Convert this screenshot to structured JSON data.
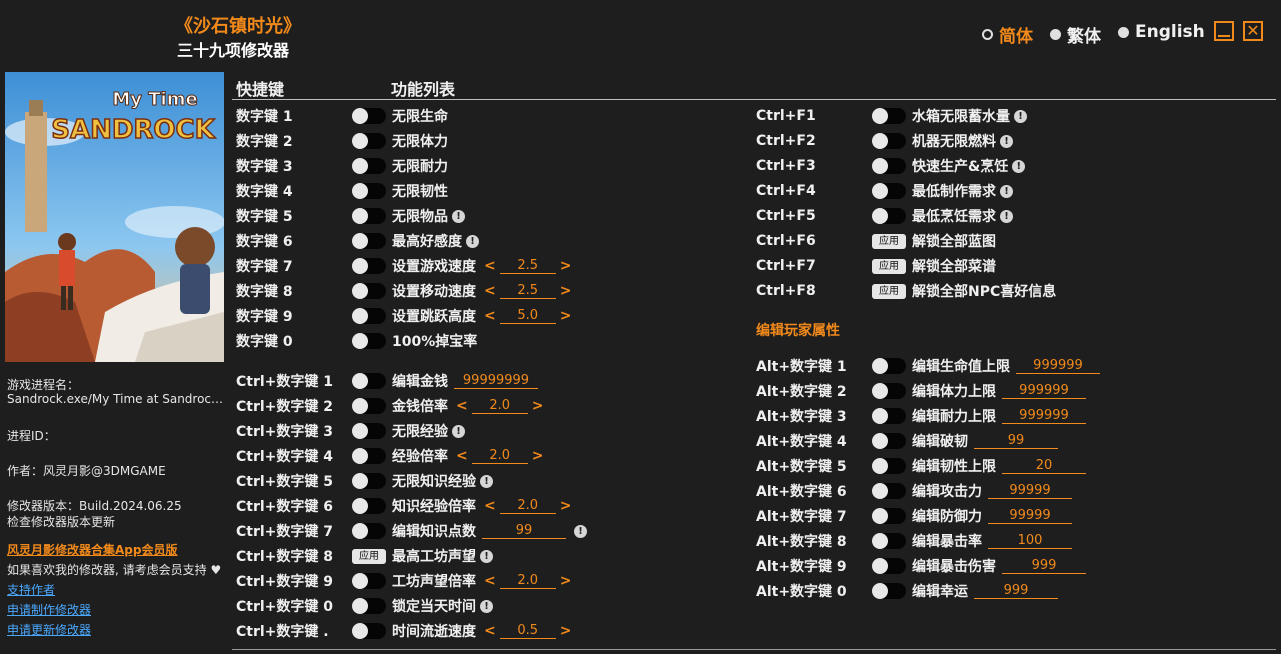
{
  "header": {
    "game_title": "《沙石镇时光》",
    "subtitle": "三十九项修改器",
    "languages": [
      {
        "label": "简体",
        "active": true
      },
      {
        "label": "繁体",
        "active": false
      },
      {
        "label": "English",
        "active": false
      }
    ],
    "minimize_icon": "minimize-icon",
    "close_icon": "close-icon"
  },
  "cover": {
    "logo_line1": "My Time",
    "logo_line2": "SANDROCK"
  },
  "sidebar": {
    "process_name_label": "游戏进程名：",
    "process_name_value": "Sandrock.exe/My Time at Sandrock.exe",
    "process_id_label": "进程ID：",
    "author": "作者：风灵月影@3DMGAME",
    "version": "修改器版本：Build.2024.06.25",
    "check_update": "检查修改器版本更新",
    "app_link": "风灵月影修改器合集App会员版",
    "support_text": "如果喜欢我的修改器, 请考虑会员支持",
    "heart_icon": "heart-icon",
    "support_author": "支持作者",
    "request_make": "申请制作修改器",
    "request_update": "申请更新修改器"
  },
  "columns": {
    "hotkey": "快捷键",
    "features": "功能列表"
  },
  "left_rows": [
    {
      "key": "数字键 1",
      "label": "无限生命",
      "control": "toggle"
    },
    {
      "key": "数字键 2",
      "label": "无限体力",
      "control": "toggle"
    },
    {
      "key": "数字键 3",
      "label": "无限耐力",
      "control": "toggle"
    },
    {
      "key": "数字键 4",
      "label": "无限韧性",
      "control": "toggle"
    },
    {
      "key": "数字键 5",
      "label": "无限物品",
      "control": "toggle",
      "warn": true
    },
    {
      "key": "数字键 6",
      "label": "最高好感度",
      "control": "toggle",
      "warn": true
    },
    {
      "key": "数字键 7",
      "label": "设置游戏速度",
      "control": "toggle",
      "value": "2.5",
      "arrows": true
    },
    {
      "key": "数字键 8",
      "label": "设置移动速度",
      "control": "toggle",
      "value": "2.5",
      "arrows": true
    },
    {
      "key": "数字键 9",
      "label": "设置跳跃高度",
      "control": "toggle",
      "value": "5.0",
      "arrows": true
    },
    {
      "key": "数字键 0",
      "label": "100%掉宝率",
      "control": "toggle"
    },
    {
      "key": "Ctrl+数字键 1",
      "label": "编辑金钱",
      "control": "toggle",
      "value": "99999999"
    },
    {
      "key": "Ctrl+数字键 2",
      "label": "金钱倍率",
      "control": "toggle",
      "value": "2.0",
      "arrows": true
    },
    {
      "key": "Ctrl+数字键 3",
      "label": "无限经验",
      "control": "toggle",
      "warn": true
    },
    {
      "key": "Ctrl+数字键 4",
      "label": "经验倍率",
      "control": "toggle",
      "value": "2.0",
      "arrows": true
    },
    {
      "key": "Ctrl+数字键 5",
      "label": "无限知识经验",
      "control": "toggle",
      "warn": true
    },
    {
      "key": "Ctrl+数字键 6",
      "label": "知识经验倍率",
      "control": "toggle",
      "value": "2.0",
      "arrows": true
    },
    {
      "key": "Ctrl+数字键 7",
      "label": "编辑知识点数",
      "control": "toggle",
      "value": "99",
      "warn": true
    },
    {
      "key": "Ctrl+数字键 8",
      "label": "最高工坊声望",
      "control": "apply",
      "warn": true
    },
    {
      "key": "Ctrl+数字键 9",
      "label": "工坊声望倍率",
      "control": "toggle",
      "value": "2.0",
      "arrows": true
    },
    {
      "key": "Ctrl+数字键 0",
      "label": "锁定当天时间",
      "control": "toggle",
      "warn": true
    },
    {
      "key": "Ctrl+数字键 .",
      "label": "时间流逝速度",
      "control": "toggle",
      "value": "0.5",
      "arrows": true
    }
  ],
  "right_rows": [
    {
      "key": "Ctrl+F1",
      "label": "水箱无限蓄水量",
      "control": "toggle",
      "warn": true
    },
    {
      "key": "Ctrl+F2",
      "label": "机器无限燃料",
      "control": "toggle",
      "warn": true
    },
    {
      "key": "Ctrl+F3",
      "label": "快速生产&烹饪",
      "control": "toggle",
      "warn": true
    },
    {
      "key": "Ctrl+F4",
      "label": "最低制作需求",
      "control": "toggle",
      "warn": true
    },
    {
      "key": "Ctrl+F5",
      "label": "最低烹饪需求",
      "control": "toggle",
      "warn": true
    },
    {
      "key": "Ctrl+F6",
      "label": "解锁全部蓝图",
      "control": "apply"
    },
    {
      "key": "Ctrl+F7",
      "label": "解锁全部菜谱",
      "control": "apply"
    },
    {
      "key": "Ctrl+F8",
      "label": "解锁全部NPC喜好信息",
      "control": "apply"
    }
  ],
  "player_section_title": "编辑玩家属性",
  "player_rows": [
    {
      "key": "Alt+数字键 1",
      "label": "编辑生命值上限",
      "control": "toggle",
      "value": "999999"
    },
    {
      "key": "Alt+数字键 2",
      "label": "编辑体力上限",
      "control": "toggle",
      "value": "999999"
    },
    {
      "key": "Alt+数字键 3",
      "label": "编辑耐力上限",
      "control": "toggle",
      "value": "999999"
    },
    {
      "key": "Alt+数字键 4",
      "label": "编辑破韧",
      "control": "toggle",
      "value": "99"
    },
    {
      "key": "Alt+数字键 5",
      "label": "编辑韧性上限",
      "control": "toggle",
      "value": "20"
    },
    {
      "key": "Alt+数字键 6",
      "label": "编辑攻击力",
      "control": "toggle",
      "value": "99999"
    },
    {
      "key": "Alt+数字键 7",
      "label": "编辑防御力",
      "control": "toggle",
      "value": "99999"
    },
    {
      "key": "Alt+数字键 8",
      "label": "编辑暴击率",
      "control": "toggle",
      "value": "100"
    },
    {
      "key": "Alt+数字键 9",
      "label": "编辑暴击伤害",
      "control": "toggle",
      "value": "999"
    },
    {
      "key": "Alt+数字键 0",
      "label": "编辑幸运",
      "control": "toggle",
      "value": "999"
    }
  ],
  "apply_label": "应用",
  "colors": {
    "accent": "#f28a1b",
    "background": "#1e1e1e",
    "link": "#4aa8ff"
  }
}
